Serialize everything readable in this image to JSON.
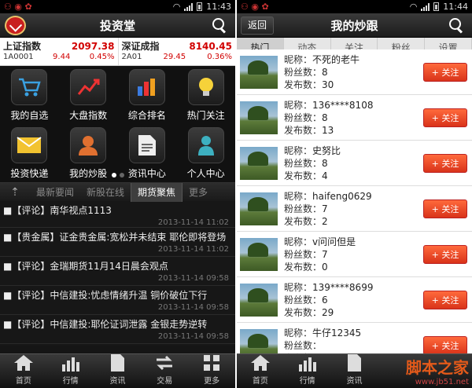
{
  "left": {
    "status_time": "11:43",
    "title": "投资堂",
    "indices": [
      {
        "name": "上证指数",
        "price": "2097.38",
        "code": "1A0001",
        "change": "9.44",
        "pct": "0.45%"
      },
      {
        "name": "深证成指",
        "price": "8140.45",
        "code": "2A01",
        "change": "29.45",
        "pct": "0.36%"
      }
    ],
    "grid": [
      {
        "label": "我的自选",
        "icon": "cart-icon"
      },
      {
        "label": "大盘指数",
        "icon": "trend-chart-icon"
      },
      {
        "label": "综合排名",
        "icon": "bar-chart-icon"
      },
      {
        "label": "热门关注",
        "icon": "lightbulb-icon"
      },
      {
        "label": "投资快递",
        "icon": "envelope-icon"
      },
      {
        "label": "我的炒股",
        "icon": "person-icon"
      },
      {
        "label": "资讯中心",
        "icon": "document-icon"
      },
      {
        "label": "个人中心",
        "icon": "user-icon"
      }
    ],
    "tabs": [
      "最新要闻",
      "新股在线",
      "期货聚焦",
      "更多"
    ],
    "active_tab": "期货聚焦",
    "news": [
      {
        "title": "■【评论】南华视点1113",
        "date": "2013-11-14 11:02"
      },
      {
        "title": "■【贵金属】证金贵金属:宽松并未结束 耶伦即将登场",
        "date": "2013-11-14 11:02"
      },
      {
        "title": "■【评论】金瑞期货11月14日晨会观点",
        "date": "2013-11-14 09:58"
      },
      {
        "title": "■【评论】中信建投:忧虑情绪升温 铜价破位下行",
        "date": "2013-11-14 09:58"
      },
      {
        "title": "■【评论】中信建投:耶伦证词泄露 金银走势逆转",
        "date": "2013-11-14 09:58"
      }
    ],
    "bottom": [
      "首页",
      "行情",
      "资讯",
      "交易",
      "更多"
    ]
  },
  "right": {
    "status_time": "11:44",
    "back": "返回",
    "title": "我的炒跟",
    "segments": [
      "热门",
      "动态",
      "关注",
      "粉丝",
      "设置"
    ],
    "active_segment": "热门",
    "follow_label": "+ 关注",
    "nick_label": "昵称：",
    "fans_label": "粉丝数：",
    "posts_label": "发布数：",
    "users": [
      {
        "nick": "不死的老牛",
        "fans": "8",
        "posts": "30"
      },
      {
        "nick": "136****8108",
        "fans": "8",
        "posts": "13"
      },
      {
        "nick": "史努比",
        "fans": "8",
        "posts": "4"
      },
      {
        "nick": "haifeng0629",
        "fans": "7",
        "posts": "2"
      },
      {
        "nick": "v问问但是",
        "fans": "7",
        "posts": "0"
      },
      {
        "nick": "139****8699",
        "fans": "6",
        "posts": "29"
      },
      {
        "nick": "牛仔12345",
        "fans": "",
        "posts": ""
      }
    ],
    "bottom": [
      "首页",
      "行情",
      "资讯"
    ],
    "watermark1": "脚本之家",
    "watermark2": "www.jb51.net"
  }
}
